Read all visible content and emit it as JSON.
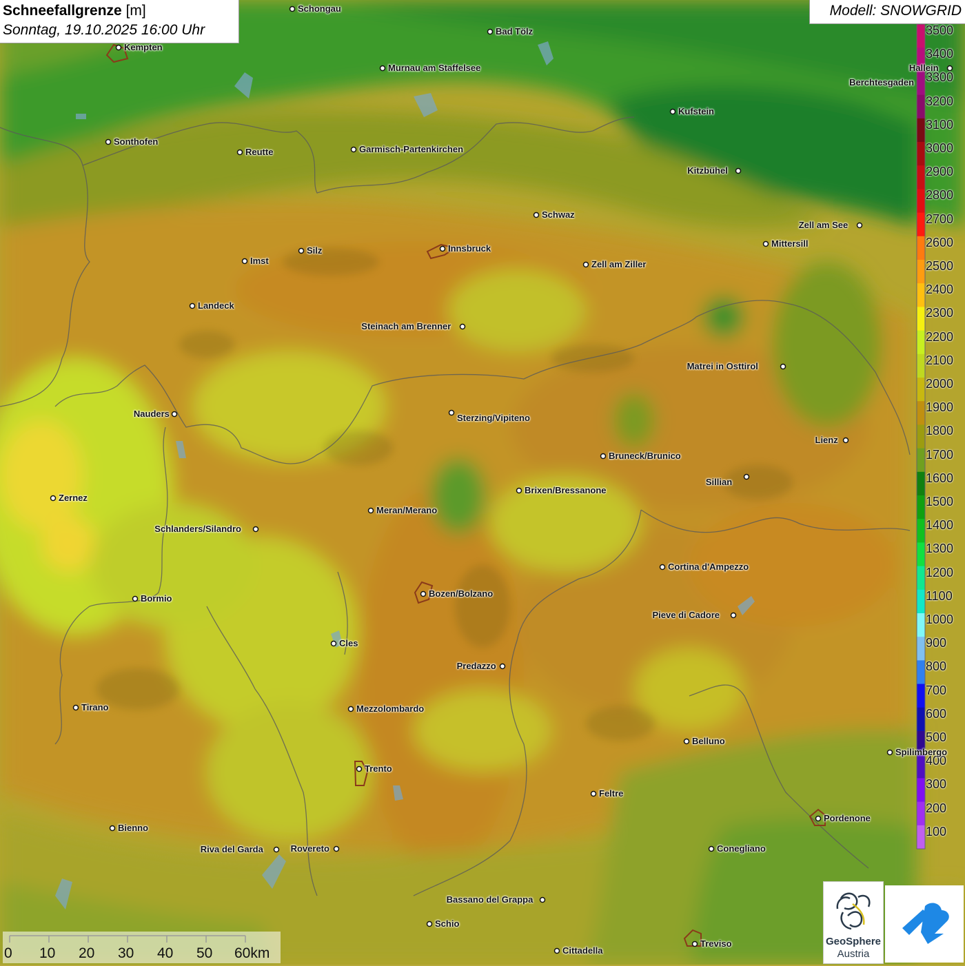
{
  "header": {
    "title_bold": "Schneefallgrenze",
    "title_unit": "[m]",
    "datetime": "Sonntag, 19.10.2025 16:00 Uhr"
  },
  "model": {
    "label": "Modell: SNOWGRID"
  },
  "legend": {
    "unit": "m",
    "entries": [
      {
        "value": "3500",
        "color": "#c8106e"
      },
      {
        "value": "3400",
        "color": "#b80e7c"
      },
      {
        "value": "3300",
        "color": "#a00e80"
      },
      {
        "value": "3200",
        "color": "#8a0c6a"
      },
      {
        "value": "3100",
        "color": "#7a0a14"
      },
      {
        "value": "3000",
        "color": "#a80c10"
      },
      {
        "value": "2900",
        "color": "#c80e14"
      },
      {
        "value": "2800",
        "color": "#e00e12"
      },
      {
        "value": "2700",
        "color": "#ff1a10"
      },
      {
        "value": "2600",
        "color": "#ff7a10"
      },
      {
        "value": "2500",
        "color": "#ff9c10"
      },
      {
        "value": "2400",
        "color": "#ffc010"
      },
      {
        "value": "2300",
        "color": "#f6f010"
      },
      {
        "value": "2200",
        "color": "#c8f020"
      },
      {
        "value": "2100",
        "color": "#c0d820"
      },
      {
        "value": "2000",
        "color": "#c8b810"
      },
      {
        "value": "1900",
        "color": "#c09010"
      },
      {
        "value": "1800",
        "color": "#9c9c10"
      },
      {
        "value": "1700",
        "color": "#70a020"
      },
      {
        "value": "1600",
        "color": "#108010"
      },
      {
        "value": "1500",
        "color": "#10a010"
      },
      {
        "value": "1400",
        "color": "#10c020"
      },
      {
        "value": "1300",
        "color": "#10e040"
      },
      {
        "value": "1200",
        "color": "#10e890"
      },
      {
        "value": "1100",
        "color": "#10e8c8"
      },
      {
        "value": "1000",
        "color": "#80f8f8"
      },
      {
        "value": "900",
        "color": "#80c0f0"
      },
      {
        "value": "800",
        "color": "#3080f0"
      },
      {
        "value": "700",
        "color": "#1010f0"
      },
      {
        "value": "600",
        "color": "#1010b0"
      },
      {
        "value": "500",
        "color": "#300890"
      },
      {
        "value": "400",
        "color": "#5010c0"
      },
      {
        "value": "300",
        "color": "#8010f0"
      },
      {
        "value": "200",
        "color": "#a030f0"
      },
      {
        "value": "100",
        "color": "#c060f0"
      }
    ]
  },
  "cities": [
    {
      "name": "Schongau"
    },
    {
      "name": "Bad Tölz"
    },
    {
      "name": "Kempten"
    },
    {
      "name": "Murnau am Staffelsee"
    },
    {
      "name": "Hallein"
    },
    {
      "name": "Berchtesgaden"
    },
    {
      "name": "Kufstein"
    },
    {
      "name": "Sonthofen"
    },
    {
      "name": "Reutte"
    },
    {
      "name": "Garmisch-Partenkirchen"
    },
    {
      "name": "Kitzbühel"
    },
    {
      "name": "Schwaz"
    },
    {
      "name": "Zell am See"
    },
    {
      "name": "Innsbruck"
    },
    {
      "name": "Silz"
    },
    {
      "name": "Imst"
    },
    {
      "name": "Mittersill"
    },
    {
      "name": "Zell am Ziller"
    },
    {
      "name": "Landeck"
    },
    {
      "name": "Steinach am Brenner"
    },
    {
      "name": "Matrei in Osttirol"
    },
    {
      "name": "Nauders"
    },
    {
      "name": "Sterzing/Vipiteno"
    },
    {
      "name": "Lienz"
    },
    {
      "name": "Bruneck/Brunico"
    },
    {
      "name": "Sillian"
    },
    {
      "name": "Zernez"
    },
    {
      "name": "Brixen/Bressanone"
    },
    {
      "name": "Meran/Merano"
    },
    {
      "name": "Schlanders/Silandro"
    },
    {
      "name": "Cortina d'Ampezzo"
    },
    {
      "name": "Bozen/Bolzano"
    },
    {
      "name": "Bormio"
    },
    {
      "name": "Pieve di Cadore"
    },
    {
      "name": "Cles"
    },
    {
      "name": "Predazzo"
    },
    {
      "name": "Tirano"
    },
    {
      "name": "Mezzolombardo"
    },
    {
      "name": "Belluno"
    },
    {
      "name": "Spilimbergo"
    },
    {
      "name": "Trento"
    },
    {
      "name": "Feltre"
    },
    {
      "name": "Pordenone"
    },
    {
      "name": "Bienno"
    },
    {
      "name": "Riva del Garda"
    },
    {
      "name": "Rovereto"
    },
    {
      "name": "Conegliano"
    },
    {
      "name": "Bassano del Grappa"
    },
    {
      "name": "Schio"
    },
    {
      "name": "Treviso"
    },
    {
      "name": "Cittadella"
    }
  ],
  "scalebar": {
    "ticks": [
      "0",
      "10",
      "20",
      "30",
      "40",
      "50",
      "60km"
    ]
  },
  "logos": {
    "geosphere_line1": "GeoSphere",
    "geosphere_line2": "Austria"
  }
}
